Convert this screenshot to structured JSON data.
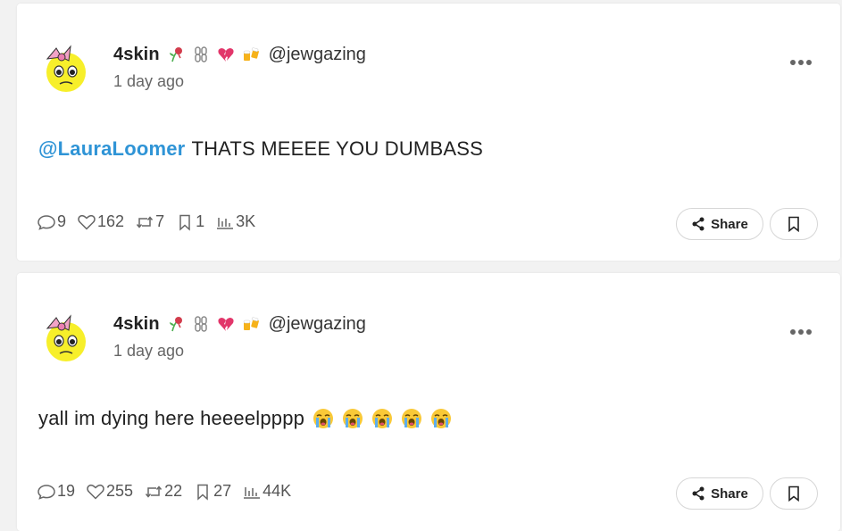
{
  "colors": {
    "mention": "#2f94d6",
    "card_bg": "#ffffff",
    "page_bg": "#f2f2f2"
  },
  "posts": [
    {
      "author": {
        "display_name": "4skin",
        "name_emojis": [
          "wilted-rose",
          "chains",
          "broken-heart",
          "beer-mugs"
        ],
        "handle": "@jewgazing",
        "avatar": "pleading-face-with-pink-bow"
      },
      "timestamp": "1 day ago",
      "mention": "@LauraLoomer",
      "text": "THATS MEEEE YOU DUMBASS",
      "trailing_emojis": [],
      "stats": {
        "replies": "9",
        "likes": "162",
        "reposts": "7",
        "bookmarks": "1",
        "views": "3K"
      },
      "share_label": "Share"
    },
    {
      "author": {
        "display_name": "4skin",
        "name_emojis": [
          "wilted-rose",
          "chains",
          "broken-heart",
          "beer-mugs"
        ],
        "handle": "@jewgazing",
        "avatar": "pleading-face-with-pink-bow"
      },
      "timestamp": "1 day ago",
      "mention": "",
      "text": "yall im dying here heeeelpppp",
      "trailing_emojis": [
        "loudly-crying-face",
        "loudly-crying-face",
        "loudly-crying-face",
        "loudly-crying-face",
        "loudly-crying-face"
      ],
      "stats": {
        "replies": "19",
        "likes": "255",
        "reposts": "22",
        "bookmarks": "27",
        "views": "44K"
      },
      "share_label": "Share"
    }
  ]
}
